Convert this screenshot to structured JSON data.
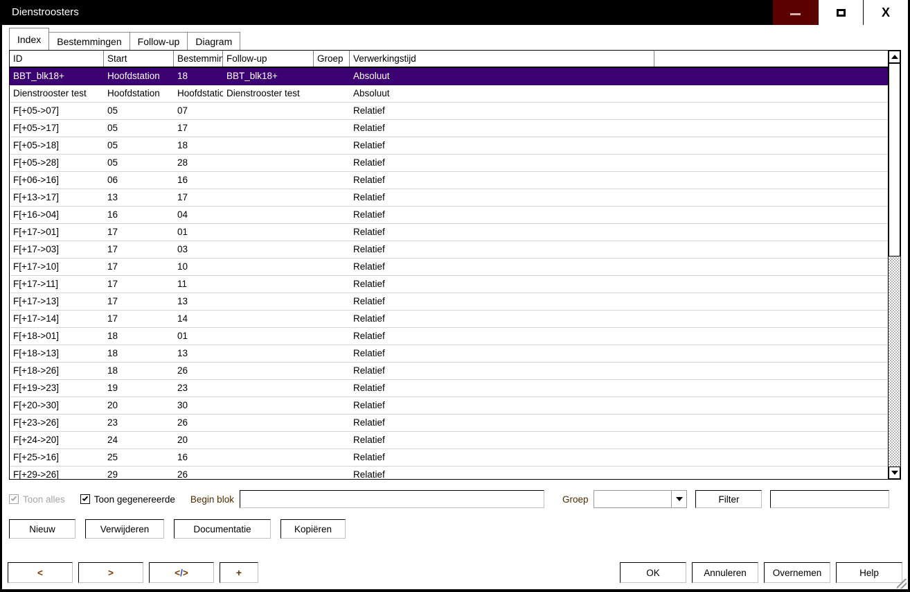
{
  "window": {
    "title": "Dienstroosters",
    "controls": {
      "minimize": "minimize-icon",
      "maximize": "maximize-icon",
      "close": "close-icon"
    }
  },
  "tabs": [
    {
      "label": "Index",
      "active": true
    },
    {
      "label": "Bestemmingen",
      "active": false
    },
    {
      "label": "Follow-up",
      "active": false
    },
    {
      "label": "Diagram",
      "active": false
    }
  ],
  "grid": {
    "columns": [
      "ID",
      "Start",
      "Bestemming",
      "Follow-up",
      "Groep",
      "Verwerkingstijd"
    ],
    "rows": [
      {
        "id": "BBT_blk18+",
        "start": "Hoofdstation",
        "bestemming": "18",
        "followup": "BBT_blk18+",
        "groep": "",
        "verwerkingstijd": "Absoluut",
        "selected": true
      },
      {
        "id": "Dienstrooster test",
        "start": "Hoofdstation",
        "bestemming": "Hoofdstation",
        "followup": "Dienstrooster test",
        "groep": "",
        "verwerkingstijd": "Absoluut",
        "selected": false
      },
      {
        "id": "F[+05->07]",
        "start": "05",
        "bestemming": "07",
        "followup": "",
        "groep": "",
        "verwerkingstijd": "Relatief",
        "selected": false
      },
      {
        "id": "F[+05->17]",
        "start": "05",
        "bestemming": "17",
        "followup": "",
        "groep": "",
        "verwerkingstijd": "Relatief",
        "selected": false
      },
      {
        "id": "F[+05->18]",
        "start": "05",
        "bestemming": "18",
        "followup": "",
        "groep": "",
        "verwerkingstijd": "Relatief",
        "selected": false
      },
      {
        "id": "F[+05->28]",
        "start": "05",
        "bestemming": "28",
        "followup": "",
        "groep": "",
        "verwerkingstijd": "Relatief",
        "selected": false
      },
      {
        "id": "F[+06->16]",
        "start": "06",
        "bestemming": "16",
        "followup": "",
        "groep": "",
        "verwerkingstijd": "Relatief",
        "selected": false
      },
      {
        "id": "F[+13->17]",
        "start": "13",
        "bestemming": "17",
        "followup": "",
        "groep": "",
        "verwerkingstijd": "Relatief",
        "selected": false
      },
      {
        "id": "F[+16->04]",
        "start": "16",
        "bestemming": "04",
        "followup": "",
        "groep": "",
        "verwerkingstijd": "Relatief",
        "selected": false
      },
      {
        "id": "F[+17->01]",
        "start": "17",
        "bestemming": "01",
        "followup": "",
        "groep": "",
        "verwerkingstijd": "Relatief",
        "selected": false
      },
      {
        "id": "F[+17->03]",
        "start": "17",
        "bestemming": "03",
        "followup": "",
        "groep": "",
        "verwerkingstijd": "Relatief",
        "selected": false
      },
      {
        "id": "F[+17->10]",
        "start": "17",
        "bestemming": "10",
        "followup": "",
        "groep": "",
        "verwerkingstijd": "Relatief",
        "selected": false
      },
      {
        "id": "F[+17->11]",
        "start": "17",
        "bestemming": "11",
        "followup": "",
        "groep": "",
        "verwerkingstijd": "Relatief",
        "selected": false
      },
      {
        "id": "F[+17->13]",
        "start": "17",
        "bestemming": "13",
        "followup": "",
        "groep": "",
        "verwerkingstijd": "Relatief",
        "selected": false
      },
      {
        "id": "F[+17->14]",
        "start": "17",
        "bestemming": "14",
        "followup": "",
        "groep": "",
        "verwerkingstijd": "Relatief",
        "selected": false
      },
      {
        "id": "F[+18->01]",
        "start": "18",
        "bestemming": "01",
        "followup": "",
        "groep": "",
        "verwerkingstijd": "Relatief",
        "selected": false
      },
      {
        "id": "F[+18->13]",
        "start": "18",
        "bestemming": "13",
        "followup": "",
        "groep": "",
        "verwerkingstijd": "Relatief",
        "selected": false
      },
      {
        "id": "F[+18->26]",
        "start": "18",
        "bestemming": "26",
        "followup": "",
        "groep": "",
        "verwerkingstijd": "Relatief",
        "selected": false
      },
      {
        "id": "F[+19->23]",
        "start": "19",
        "bestemming": "23",
        "followup": "",
        "groep": "",
        "verwerkingstijd": "Relatief",
        "selected": false
      },
      {
        "id": "F[+20->30]",
        "start": "20",
        "bestemming": "30",
        "followup": "",
        "groep": "",
        "verwerkingstijd": "Relatief",
        "selected": false
      },
      {
        "id": "F[+23->26]",
        "start": "23",
        "bestemming": "26",
        "followup": "",
        "groep": "",
        "verwerkingstijd": "Relatief",
        "selected": false
      },
      {
        "id": "F[+24->20]",
        "start": "24",
        "bestemming": "20",
        "followup": "",
        "groep": "",
        "verwerkingstijd": "Relatief",
        "selected": false
      },
      {
        "id": "F[+25->16]",
        "start": "25",
        "bestemming": "16",
        "followup": "",
        "groep": "",
        "verwerkingstijd": "Relatief",
        "selected": false
      },
      {
        "id": "F[+29->26]",
        "start": "29",
        "bestemming": "26",
        "followup": "",
        "groep": "",
        "verwerkingstijd": "Relatief",
        "selected": false
      }
    ],
    "scrollbar": {
      "up": "scroll-up-icon",
      "down": "scroll-down-icon"
    }
  },
  "filter_row": {
    "toon_alles": {
      "label": "Toon alles",
      "checked": true,
      "disabled": true
    },
    "toon_gegenereerde": {
      "label": "Toon gegenereerde",
      "checked": true,
      "disabled": false
    },
    "begin_blok": {
      "label": "Begin blok",
      "value": "",
      "placeholder": ""
    },
    "groep": {
      "label": "Groep",
      "value": "",
      "options": []
    },
    "filter_button": "Filter",
    "filter_value": {
      "value": "",
      "placeholder": ""
    }
  },
  "actions": {
    "nieuw": "Nieuw",
    "verwijderen": "Verwijderen",
    "documentatie": "Documentatie",
    "kopieren": "Kopiëren"
  },
  "bottom": {
    "prev": "<",
    "next": ">",
    "code": "</>",
    "add": "+",
    "ok": "OK",
    "cancel": "Annuleren",
    "apply": "Overnemen",
    "help": "Help"
  },
  "colors": {
    "selection": "#3b0072",
    "titlebar": "#000000",
    "minimize_bg": "#5a0000",
    "label_accent": "#4a2d00",
    "nav_glyph": "#7a3b00",
    "code_glyph_blue": "#2b4fcf"
  }
}
